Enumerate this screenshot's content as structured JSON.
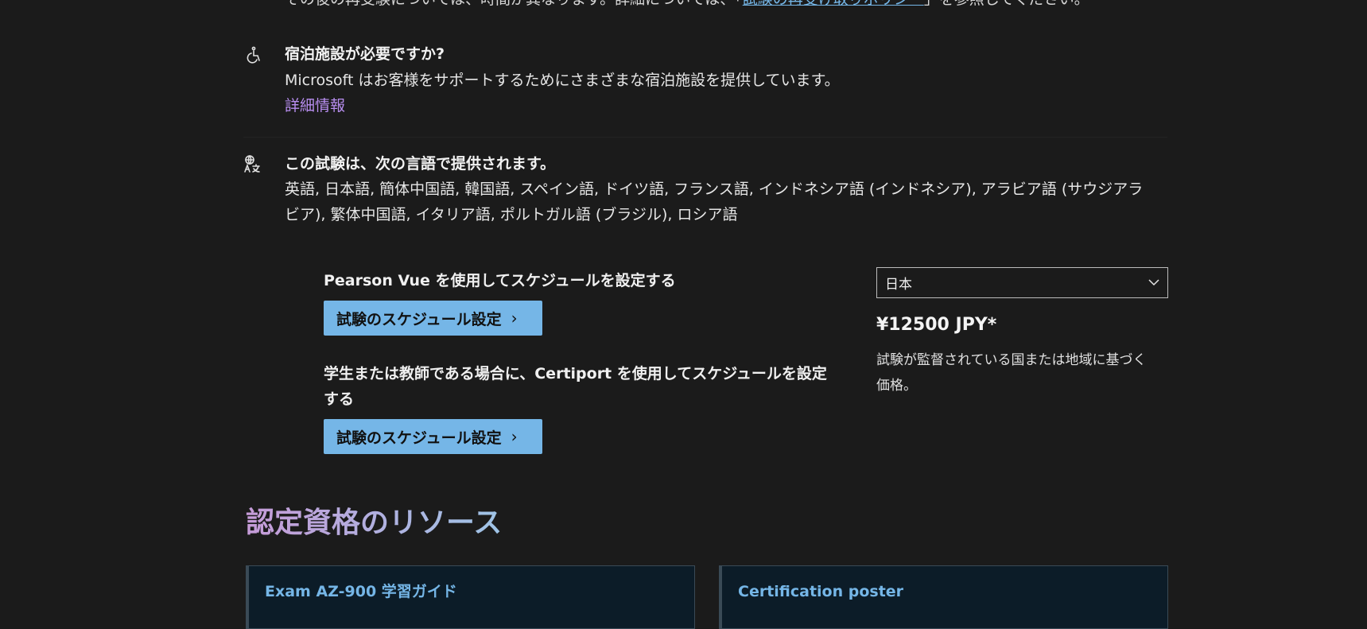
{
  "retake": {
    "text_before": "その後の再受験については、時間が異なります。詳細については、「",
    "link": "試験の再受け取りポリシー",
    "text_after": "」を参照してください。"
  },
  "accommodations": {
    "icon": "accessibility-icon",
    "title": "宿泊施設が必要ですか?",
    "description": "Microsoft はお客様をサポートするためにさまざまな宿泊施設を提供しています。",
    "link": "詳細情報"
  },
  "languages": {
    "icon": "translate-icon",
    "title": "この試験は、次の言語で提供されます。",
    "line1": "英語, 日本語, 簡体中国語, 韓国語, スペイン語, ドイツ語, フランス語, インドネシア語 (インドネシア), アラビア語 (サウジアラ",
    "line2": "ビア), 繁体中国語, イタリア語, ポルトガル語 (ブラジル), ロシア語"
  },
  "scheduling": {
    "pearson_label": "Pearson Vue を使用してスケジュールを設定する",
    "pearson_button": "試験のスケジュール設定",
    "certiport_label_line1": "学生または教師である場合に、Certiport を使用してスケジュールを設定",
    "certiport_label_line2": "する",
    "certiport_button": "試験のスケジュール設定"
  },
  "pricing": {
    "country_selected": "日本",
    "price": "¥12500 JPY*",
    "note_line1": "試験が監督されている国または地域に基づく",
    "note_line2": "価格。"
  },
  "resources": {
    "title": "認定資格のリソース",
    "cards": [
      {
        "title": "Exam AZ-900 学習ガイド"
      },
      {
        "title": "Certification poster"
      }
    ]
  },
  "colors": {
    "background": "#1b1b1b",
    "button": "#75b6e7",
    "link_purple": "#b88ef0",
    "link_blue": "#75b6e7",
    "card_bg": "#0c1c28"
  }
}
